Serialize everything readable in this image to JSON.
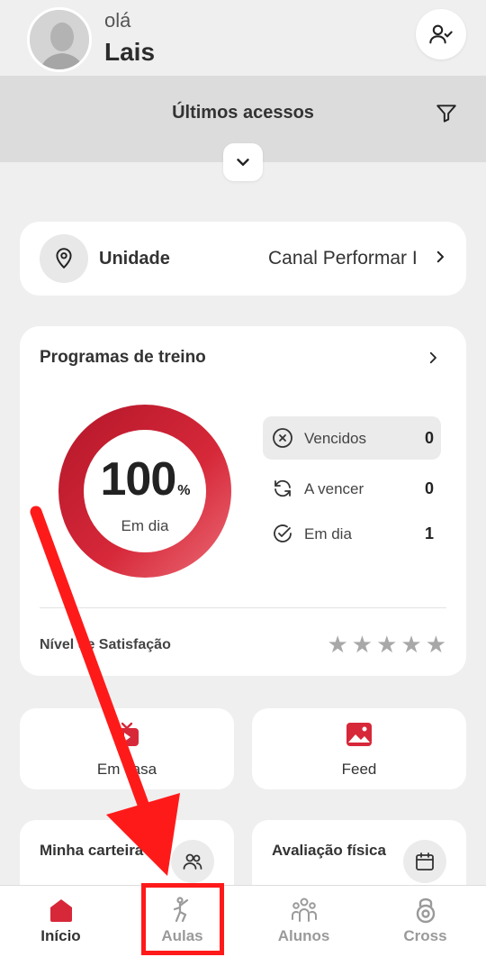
{
  "header": {
    "greeting": "olá",
    "user_name": "Lais"
  },
  "recent": {
    "title": "Últimos acessos"
  },
  "unit": {
    "label": "Unidade",
    "value": "Canal Performar I"
  },
  "programs": {
    "title": "Programas de treino",
    "percent": "100",
    "percent_sign": "%",
    "percent_label": "Em dia",
    "stats": [
      {
        "label": "Vencidos",
        "value": "0"
      },
      {
        "label": "A vencer",
        "value": "0"
      },
      {
        "label": "Em dia",
        "value": "1"
      }
    ],
    "satisfaction_label": "Nível de Satisfação",
    "rating": 0
  },
  "tiles": {
    "casa": "Em casa",
    "feed": "Feed",
    "wallet": "Minha carteira",
    "eval": "Avaliação física"
  },
  "nav": [
    {
      "label": "Início"
    },
    {
      "label": "Aulas"
    },
    {
      "label": "Alunos"
    },
    {
      "label": "Cross"
    }
  ],
  "colors": {
    "accent": "#d62839",
    "annotation": "#ff1a1a"
  }
}
